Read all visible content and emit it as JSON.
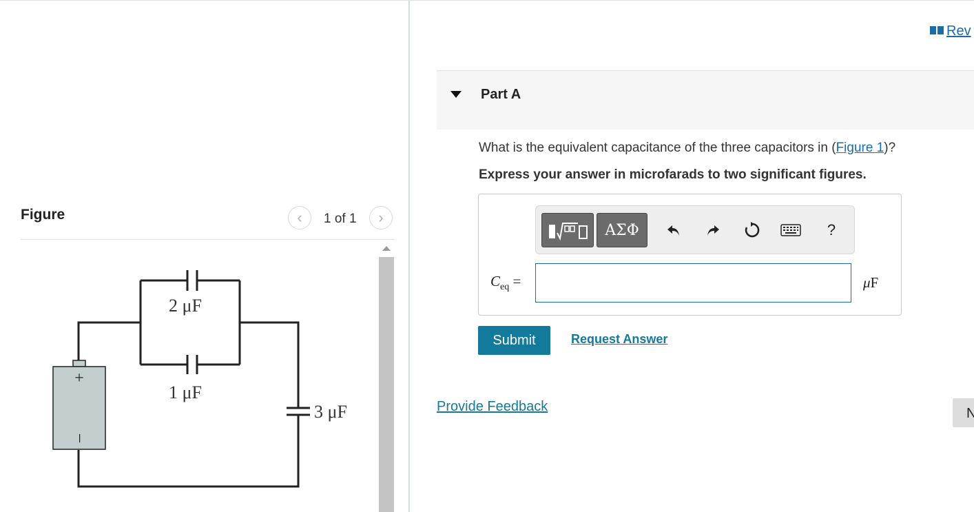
{
  "review": {
    "label": "Rev",
    "icon": "book-icon"
  },
  "figure_panel": {
    "title": "Figure",
    "pager_text": "1 of 1",
    "capacitor_labels": [
      "2 μF",
      "1 μF",
      "3 μF"
    ],
    "battery_plus": "+",
    "battery_minus": "−"
  },
  "part": {
    "title": "Part A",
    "question_prefix": "What is the equivalent capacitance of the three capacitors in (",
    "figure_link": "Figure 1",
    "question_suffix": ")?",
    "instruction": "Express your answer in microfarads to two significant figures."
  },
  "answer": {
    "variable": "C",
    "subscript": "eq",
    "equals": "=",
    "value": "",
    "unit_prefix": "μ",
    "unit": "F",
    "toolbar": {
      "templates_icon": "math-templates-icon",
      "greek_label": "ΑΣΦ",
      "undo_icon": "undo-icon",
      "redo_icon": "redo-icon",
      "reset_icon": "reset-icon",
      "keyboard_icon": "keyboard-icon",
      "help_label": "?"
    }
  },
  "buttons": {
    "submit": "Submit",
    "request_answer": "Request Answer",
    "provide_feedback": "Provide Feedback",
    "next_partial": "N"
  },
  "colors": {
    "link": "#1a6da3",
    "submit_bg": "#137a9c",
    "battery_fill": "#c3cece"
  }
}
